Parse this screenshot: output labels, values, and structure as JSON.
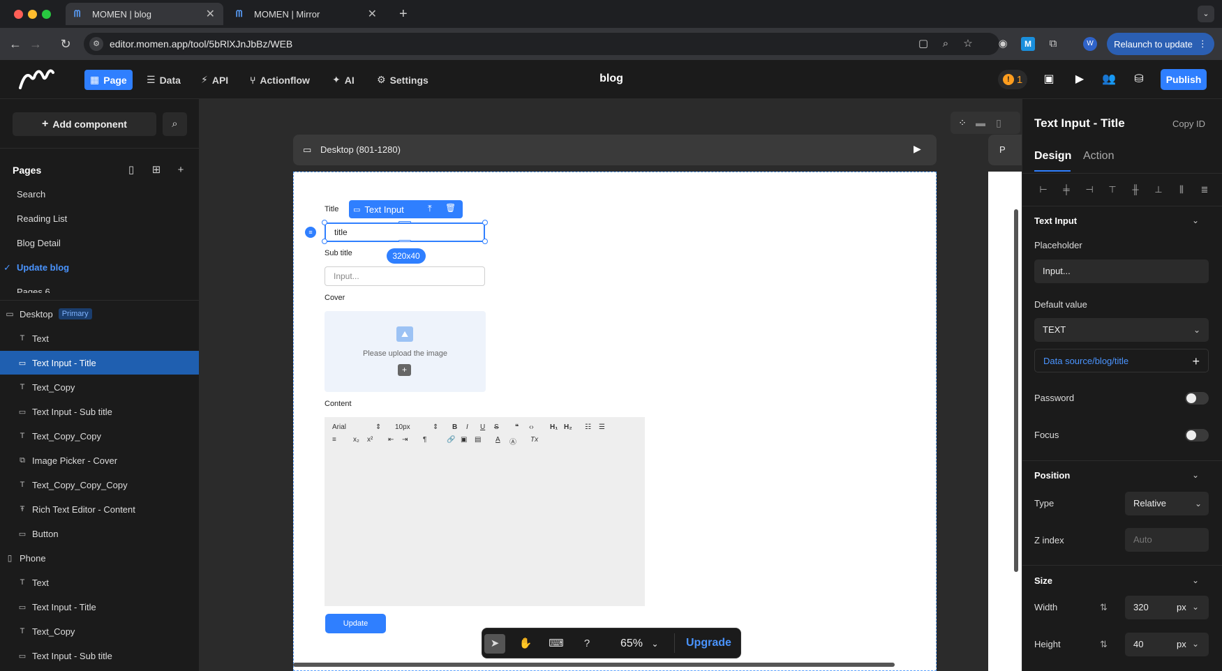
{
  "browser": {
    "tabs": [
      {
        "label": "MOMEN | blog",
        "active": true
      },
      {
        "label": "MOMEN | Mirror",
        "active": false
      }
    ],
    "url": "editor.momen.app/tool/5bRlXJnJbBz/WEB",
    "relaunch_label": "Relaunch to update",
    "profile_initial": "W"
  },
  "header": {
    "nav": [
      {
        "label": "Page",
        "icon": "page-icon",
        "active": true
      },
      {
        "label": "Data",
        "icon": "database-icon",
        "active": false
      },
      {
        "label": "API",
        "icon": "api-icon",
        "active": false
      },
      {
        "label": "Actionflow",
        "icon": "actionflow-icon",
        "active": false
      },
      {
        "label": "AI",
        "icon": "ai-icon",
        "active": false
      },
      {
        "label": "Settings",
        "icon": "gear-icon",
        "active": false
      }
    ],
    "title": "blog",
    "warning_count": "1",
    "publish_label": "Publish"
  },
  "sidebar": {
    "add_component_label": "Add component",
    "pages_heading": "Pages",
    "pages": [
      {
        "label": "Search",
        "active": false
      },
      {
        "label": "Reading List",
        "active": false
      },
      {
        "label": "Blog Detail",
        "active": false
      },
      {
        "label": "Update blog",
        "active": true
      },
      {
        "label": "Pages 6",
        "active": false
      }
    ],
    "desktop_label": "Desktop",
    "primary_badge": "Primary",
    "desktop_layers": [
      {
        "label": "Text",
        "type": "text",
        "selected": false
      },
      {
        "label": "Text Input - Title",
        "type": "input",
        "selected": true
      },
      {
        "label": "Text_Copy",
        "type": "text",
        "selected": false
      },
      {
        "label": "Text Input - Sub title",
        "type": "input",
        "selected": false
      },
      {
        "label": "Text_Copy_Copy",
        "type": "text",
        "selected": false
      },
      {
        "label": "Image Picker - Cover",
        "type": "image",
        "selected": false
      },
      {
        "label": "Text_Copy_Copy_Copy",
        "type": "text",
        "selected": false
      },
      {
        "label": "Rich Text Editor - Content",
        "type": "richtext",
        "selected": false
      },
      {
        "label": "Button",
        "type": "button",
        "selected": false
      }
    ],
    "phone_label": "Phone",
    "phone_layers": [
      {
        "label": "Text",
        "type": "text"
      },
      {
        "label": "Text Input - Title",
        "type": "input"
      },
      {
        "label": "Text_Copy",
        "type": "text"
      },
      {
        "label": "Text Input - Sub title",
        "type": "input"
      }
    ]
  },
  "canvas": {
    "device_label": "Desktop (801-1280)",
    "side_device_label": "P",
    "form": {
      "title_label": "Title",
      "title_value": "title",
      "selection_chip": "Text Input",
      "size_badge": "320x40",
      "subtitle_label": "Sub title",
      "subtitle_placeholder": "Input...",
      "cover_label": "Cover",
      "cover_prompt": "Please upload the image",
      "content_label": "Content",
      "rte_font": "Arial",
      "rte_size": "10px",
      "update_label": "Update"
    },
    "zoom": "65%",
    "upgrade_label": "Upgrade"
  },
  "inspector": {
    "title": "Text Input - Title",
    "copy_id_label": "Copy ID",
    "tabs": [
      {
        "label": "Design",
        "active": true
      },
      {
        "label": "Action",
        "active": false
      }
    ],
    "text_input_section": "Text Input",
    "placeholder_label": "Placeholder",
    "placeholder_value": "Input...",
    "default_value_label": "Default value",
    "default_value_type": "TEXT",
    "data_source": "Data source/blog/title",
    "password_label": "Password",
    "password_on": false,
    "focus_label": "Focus",
    "focus_on": false,
    "position_section": "Position",
    "type_label": "Type",
    "type_value": "Relative",
    "zindex_label": "Z index",
    "zindex_placeholder": "Auto",
    "size_section": "Size",
    "width_label": "Width",
    "width_value": "320",
    "width_unit": "px",
    "height_label": "Height",
    "height_value": "40",
    "height_unit": "px"
  },
  "colors": {
    "accent": "#2f7fff",
    "selected_layer": "#1f5fb0",
    "warning": "#ff9d1e"
  }
}
